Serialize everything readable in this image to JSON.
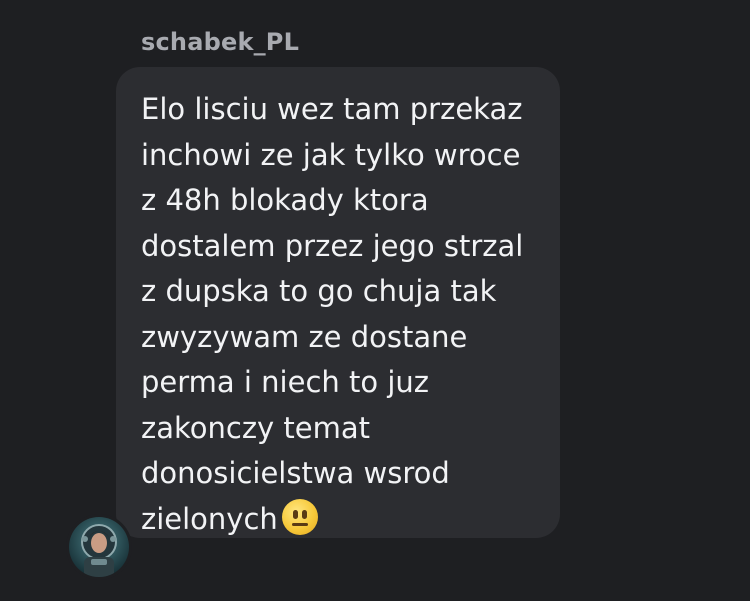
{
  "sender": {
    "name": "schabek_PL"
  },
  "message": {
    "lines": [
      "Elo lisciu wez tam przekaz",
      "inchowi ze jak tylko wroce",
      "z 48h blokady ktora",
      "dostalem przez jego strzal",
      "z dupska to go chuja tak",
      "zwyzywam ze dostane",
      "perma i niech to juz",
      "zakonczy temat",
      "donosicielstwa wsrod",
      "zielonych"
    ],
    "emoji": "neutral-face-emoji"
  },
  "avatar": {
    "icon": "astronaut-avatar"
  },
  "colors": {
    "background": "#1e1f22",
    "bubble": "#2c2d31",
    "text": "#f2f3f5",
    "sender": "#a8aab0"
  }
}
